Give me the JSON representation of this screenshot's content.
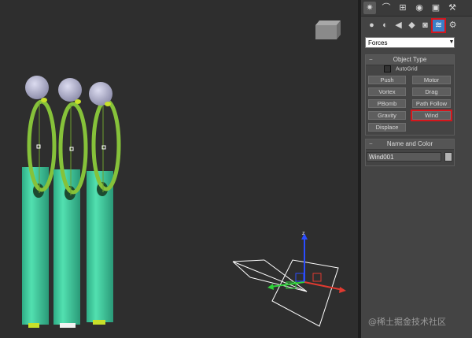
{
  "command_panel": {
    "tabs": [
      {
        "icon": "create-sun-icon",
        "glyph": "✷"
      },
      {
        "icon": "modify-curve-icon",
        "glyph": "⌒"
      },
      {
        "icon": "hierarchy-icon",
        "glyph": "⊞"
      },
      {
        "icon": "motion-icon",
        "glyph": "◉"
      },
      {
        "icon": "display-icon",
        "glyph": "▣"
      },
      {
        "icon": "utilities-hammer-icon",
        "glyph": "⚒"
      }
    ],
    "categories": [
      {
        "icon": "geometry-sphere-icon",
        "glyph": "●"
      },
      {
        "icon": "shapes-icon",
        "glyph": "◐"
      },
      {
        "icon": "lights-icon",
        "glyph": "◀"
      },
      {
        "icon": "cameras-icon",
        "glyph": "◆"
      },
      {
        "icon": "helpers-icon",
        "glyph": "◙"
      },
      {
        "icon": "space-warps-icon",
        "glyph": "≋",
        "selected": true
      },
      {
        "icon": "systems-icon",
        "glyph": "⚙"
      }
    ],
    "subcategory": "Forces",
    "object_type": {
      "title": "Object Type",
      "autogrid_label": "AutoGrid",
      "buttons": [
        "Push",
        "Motor",
        "Vortex",
        "Drag",
        "PBomb",
        "Path Follow",
        "Gravity",
        "Wind",
        "Displace"
      ],
      "highlighted": "Wind"
    },
    "name_and_color": {
      "title": "Name and Color",
      "name_value": "Wind001",
      "color": "#b3b3b3"
    }
  },
  "viewport": {
    "axis_label": "z",
    "tube_color": "#3fcf9f",
    "spring_color": "#86c23a",
    "sphere_color": "#b6b6d6",
    "background": "#2e2e2e"
  },
  "watermark": "@稀土掘金技术社区"
}
